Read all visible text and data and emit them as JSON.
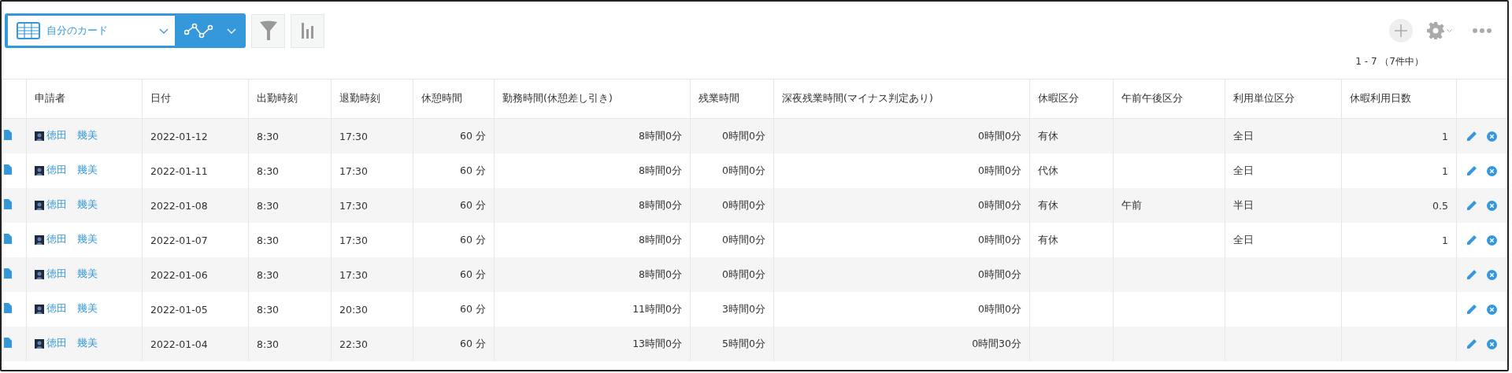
{
  "toolbar": {
    "view_name": "自分のカード"
  },
  "pagination": {
    "range": "1 - 7",
    "total": "（7件中）"
  },
  "table": {
    "columns": [
      "申請者",
      "日付",
      "出勤時刻",
      "退勤時刻",
      "休憩時間",
      "勤務時間(休憩差し引き)",
      "残業時間",
      "深夜残業時間(マイナス判定あり)",
      "休暇区分",
      "午前午後区分",
      "利用単位区分",
      "休暇利用日数"
    ],
    "rows": [
      {
        "cells": [
          "徳田　幾美",
          "2022-01-12",
          "8:30",
          "17:30",
          "60 分",
          "8時間0分",
          "0時間0分",
          "0時間0分",
          "有休",
          "",
          "全日",
          "1"
        ]
      },
      {
        "cells": [
          "徳田　幾美",
          "2022-01-11",
          "8:30",
          "17:30",
          "60 分",
          "8時間0分",
          "0時間0分",
          "0時間0分",
          "代休",
          "",
          "全日",
          "1"
        ]
      },
      {
        "cells": [
          "徳田　幾美",
          "2022-01-08",
          "8:30",
          "17:30",
          "60 分",
          "8時間0分",
          "0時間0分",
          "0時間0分",
          "有休",
          "午前",
          "半日",
          "0.5"
        ]
      },
      {
        "cells": [
          "徳田　幾美",
          "2022-01-07",
          "8:30",
          "17:30",
          "60 分",
          "8時間0分",
          "0時間0分",
          "0時間0分",
          "有休",
          "",
          "全日",
          "1"
        ]
      },
      {
        "cells": [
          "徳田　幾美",
          "2022-01-06",
          "8:30",
          "17:30",
          "60 分",
          "8時間0分",
          "0時間0分",
          "0時間0分",
          "",
          "",
          "",
          ""
        ]
      },
      {
        "cells": [
          "徳田　幾美",
          "2022-01-05",
          "8:30",
          "20:30",
          "60 分",
          "11時間0分",
          "3時間0分",
          "0時間0分",
          "",
          "",
          "",
          ""
        ]
      },
      {
        "cells": [
          "徳田　幾美",
          "2022-01-04",
          "8:30",
          "22:30",
          "60 分",
          "13時間0分",
          "5時間0分",
          "0時間30分",
          "",
          "",
          "",
          ""
        ]
      }
    ]
  }
}
